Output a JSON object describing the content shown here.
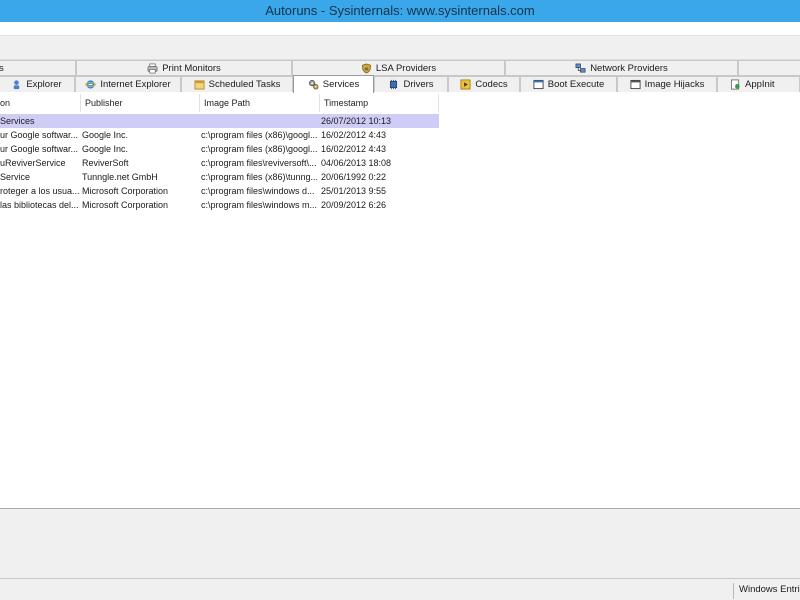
{
  "window": {
    "title": "Autoruns - Sysinternals: www.sysinternals.com"
  },
  "tabs_row1": [
    {
      "label": "s",
      "icon": "none"
    },
    {
      "label": "Print Monitors",
      "icon": "printer-icon"
    },
    {
      "label": "LSA Providers",
      "icon": "lsa-shield-icon"
    },
    {
      "label": "Network Providers",
      "icon": "network-icon"
    },
    {
      "label": "",
      "icon": "none"
    }
  ],
  "tabs_row2": [
    {
      "label": "Explorer",
      "icon": "explorer-icon"
    },
    {
      "label": "Internet Explorer",
      "icon": "internet-explorer-icon"
    },
    {
      "label": "Scheduled Tasks",
      "icon": "scheduled-tasks-icon"
    },
    {
      "label": "Services",
      "icon": "services-gear-icon",
      "active": true
    },
    {
      "label": "Drivers",
      "icon": "drivers-icon"
    },
    {
      "label": "Codecs",
      "icon": "codecs-icon"
    },
    {
      "label": "Boot Execute",
      "icon": "boot-execute-icon"
    },
    {
      "label": "Image Hijacks",
      "icon": "image-hijacks-icon"
    },
    {
      "label": "AppInit",
      "icon": "appinit-icon"
    }
  ],
  "columns": [
    "on",
    "Publisher",
    "Image Path",
    "Timestamp"
  ],
  "rows": [
    {
      "description": "Services",
      "publisher": "",
      "path": "",
      "timestamp": "26/07/2012 10:13",
      "selected": true
    },
    {
      "description": "ur Google softwar...",
      "publisher": "Google Inc.",
      "path": "c:\\program files (x86)\\googl...",
      "timestamp": "16/02/2012 4:43"
    },
    {
      "description": "ur Google softwar...",
      "publisher": "Google Inc.",
      "path": "c:\\program files (x86)\\googl...",
      "timestamp": "16/02/2012 4:43"
    },
    {
      "description": "uReviverService",
      "publisher": "ReviverSoft",
      "path": "c:\\program files\\reviversoft\\...",
      "timestamp": "04/06/2013 18:08"
    },
    {
      "description": "Service",
      "publisher": "Tunngle.net GmbH",
      "path": "c:\\program files (x86)\\tunng...",
      "timestamp": "20/06/1992 0:22"
    },
    {
      "description": "roteger a los usua...",
      "publisher": "Microsoft Corporation",
      "path": "c:\\program files\\windows d...",
      "timestamp": "25/01/2013 9:55"
    },
    {
      "description": "las bibliotecas del...",
      "publisher": "Microsoft Corporation",
      "path": "c:\\program files\\windows m...",
      "timestamp": "20/09/2012 6:26"
    }
  ],
  "status": {
    "text": "Windows Entrie"
  },
  "colors": {
    "titlebar": "#3aa7ea",
    "selection": "#cdcdf5",
    "chrome": "#f0f0f0"
  }
}
